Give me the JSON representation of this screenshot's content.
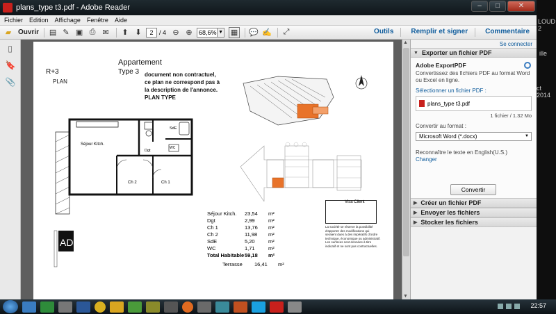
{
  "window": {
    "title": "plans_type t3.pdf - Adobe Reader"
  },
  "menu": [
    "Fichier",
    "Edition",
    "Affichage",
    "Fenêtre",
    "Aide"
  ],
  "toolbar": {
    "open_label": "Ouvrir",
    "page_current": "2",
    "page_total": "/ 4",
    "zoom": "68,6%",
    "tools": "Outils",
    "fill_sign": "Remplir et signer",
    "comment": "Commentaire"
  },
  "page": {
    "title": "Appartement",
    "type": "Type 3",
    "floor": "R+3",
    "plan_label": "PLAN",
    "disclaimer": "document non contractuel, ce plan ne correspond pas à la description de l'annonce.   PLAN TYPE",
    "rooms": [
      {
        "name": "Séjour Kitch.",
        "area": "23,54",
        "unit": "m²"
      },
      {
        "name": "Dgt",
        "area": "2,99",
        "unit": "m²"
      },
      {
        "name": "Ch 1",
        "area": "13,76",
        "unit": "m²"
      },
      {
        "name": "Ch 2",
        "area": "11,98",
        "unit": "m²"
      },
      {
        "name": "SdE",
        "area": "5,20",
        "unit": "m²"
      },
      {
        "name": "WC",
        "area": "1,71",
        "unit": "m²"
      }
    ],
    "total": {
      "name": "Total Habitable",
      "area": "59,18",
      "unit": "m²"
    },
    "terrace": {
      "name": "Terrasse",
      "area": "16,41",
      "unit": "m²"
    },
    "visa_label": "Visa Client",
    "fineprint": "La société se réserve la possibilité d'apporter des modifications qui seraient dues à des impératifs d'ordre technique, économique ou administratif. Les surfaces sont données à titre indicatif et ne sont pas contractuelles.",
    "room_labels": {
      "sejour": "Séjour Kitch.",
      "ch1": "Ch 1",
      "ch2": "Ch 2",
      "sde": "SdE",
      "dgt": "Dgt",
      "wc": "WC"
    }
  },
  "right_pane": {
    "connect": "Se connecter",
    "export_header": "Exporter un fichier PDF",
    "service_name": "Adobe ExportPDF",
    "service_desc": "Convertissez des fichiers PDF au format Word ou Excel en ligne.",
    "select_pdf": "Sélectionner un fichier PDF :",
    "file_name": "plans_type t3.pdf",
    "file_count": "1 fichier / 1.32 Mo",
    "convert_to": "Convertir au format :",
    "format": "Microsoft Word (*.docx)",
    "recognize": "Reconnaître le texte en English(U.S.)",
    "change": "Changer",
    "convert_btn": "Convertir",
    "sections": [
      "Créer un fichier PDF",
      "Envoyer les fichiers",
      "Stocker les fichiers"
    ]
  },
  "taskbar": {
    "clock": "22:57"
  },
  "background_text": {
    "cloud": "LOUD 2",
    "mille": "ille",
    "date": "ct 2014"
  },
  "colors": {
    "accent": "#0f5c9c",
    "highlight": "#e8732a",
    "pdf_red": "#c8201c"
  }
}
